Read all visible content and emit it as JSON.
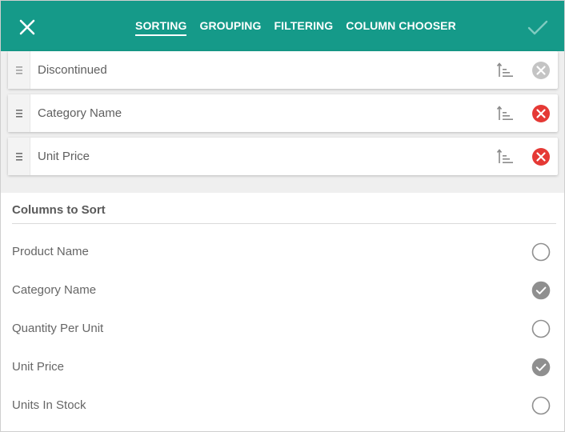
{
  "header": {
    "close_icon": "close-icon",
    "apply_icon": "check-icon",
    "tabs": [
      {
        "label": "SORTING",
        "active": true
      },
      {
        "label": "GROUPING",
        "active": false
      },
      {
        "label": "FILTERING",
        "active": false
      },
      {
        "label": "COLUMN CHOOSER",
        "active": false
      }
    ],
    "colors": {
      "brand": "#159a89",
      "tab_text": "#ffffff"
    }
  },
  "sort_list": [
    {
      "label": "Discontinued",
      "removable_enabled": false
    },
    {
      "label": "Category Name",
      "removable_enabled": true
    },
    {
      "label": "Unit Price",
      "removable_enabled": true
    }
  ],
  "sort_colors": {
    "remove_active": "#e53935",
    "remove_disabled": "#c4c4c4",
    "icon": "#8a8a8a"
  },
  "columns": {
    "title": "Columns to Sort",
    "items": [
      {
        "label": "Product Name",
        "checked": false
      },
      {
        "label": "Category Name",
        "checked": true
      },
      {
        "label": "Quantity Per Unit",
        "checked": false
      },
      {
        "label": "Unit Price",
        "checked": true
      },
      {
        "label": "Units In Stock",
        "checked": false
      }
    ]
  }
}
